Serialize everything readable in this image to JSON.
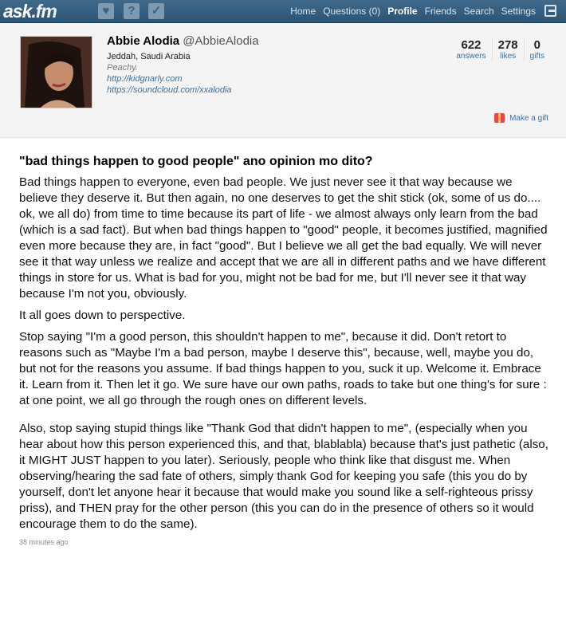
{
  "topbar": {
    "logo_main": "ask",
    "logo_ext": ".fm",
    "icons": [
      "heart-icon",
      "question-icon",
      "check-icon"
    ],
    "nav": [
      "Home",
      "Questions (0)",
      "Profile",
      "Friends",
      "Search",
      "Settings"
    ],
    "logout_icon": "logout-icon"
  },
  "profile": {
    "name": "Abbie Alodia",
    "handle": "@AbbieAlodia",
    "location": "Jeddah, Saudi Arabia",
    "bio": "Peachy.",
    "links": [
      "http://kidgnarly.com",
      "https://soundcloud.com/xxalodia"
    ],
    "stats": [
      {
        "num": "622",
        "label": "answers"
      },
      {
        "num": "278",
        "label": "likes"
      },
      {
        "num": "0",
        "label": "gifts"
      }
    ],
    "gift_label": "Make a gift",
    "gift_icon": "gift-icon"
  },
  "question": "\"bad things happen to good people\" ano opinion mo dito?",
  "answer": [
    "Bad things happen to everyone, even bad people. We just never see it that way because we believe they deserve it. But then again, no one deserves to get the shit stick (ok, some of us do.... ok, we all do) from time to time because its part of life - we almost always only learn from the bad (which is a sad fact). But when bad things happen to \"good\" people, it becomes justified, magnified even more because they are, in fact \"good\". But I believe we all get the bad equally. We will never see it that way unless we realize and accept that we are all in different paths and we have different things in store for us. What is bad for you, might not be bad for me, but I'll never see it that way because I'm not you, obviously.",
    "It all goes down to perspective.",
    "Stop saying \"I'm a good person, this shouldn't happen to me\", because it did. Don't retort to reasons such as \"Maybe I'm a bad person, maybe I deserve this\", because, well, maybe you do, but not for the reasons you assume. If bad things happen to you, suck it up. Welcome it. Embrace it. Learn from it. Then let it go. We sure have our own paths, roads to take but one thing's for sure : at one point, we all go through the rough ones on different levels.",
    "Also, stop saying stupid things like \"Thank God that didn't happen to me\", (especially when you hear about how this person experienced this, and that, blablabla) because that's just pathetic (also, it MIGHT JUST happen to you later). Seriously, people who think like that disgust me. When observing/hearing the sad fate of others, simply thank God for keeping you safe (this you do by yourself, don't let anyone hear it because that would make you sound like a self-righteous prissy priss), and THEN pray for the other person (this you can do in the presence of others so it would encourage them to do the same)."
  ],
  "timestamp": "38 minutes ago",
  "colors": {
    "topbar": "#34607f",
    "link": "#3d6f9a",
    "header_bg": "#f4f4f4"
  }
}
